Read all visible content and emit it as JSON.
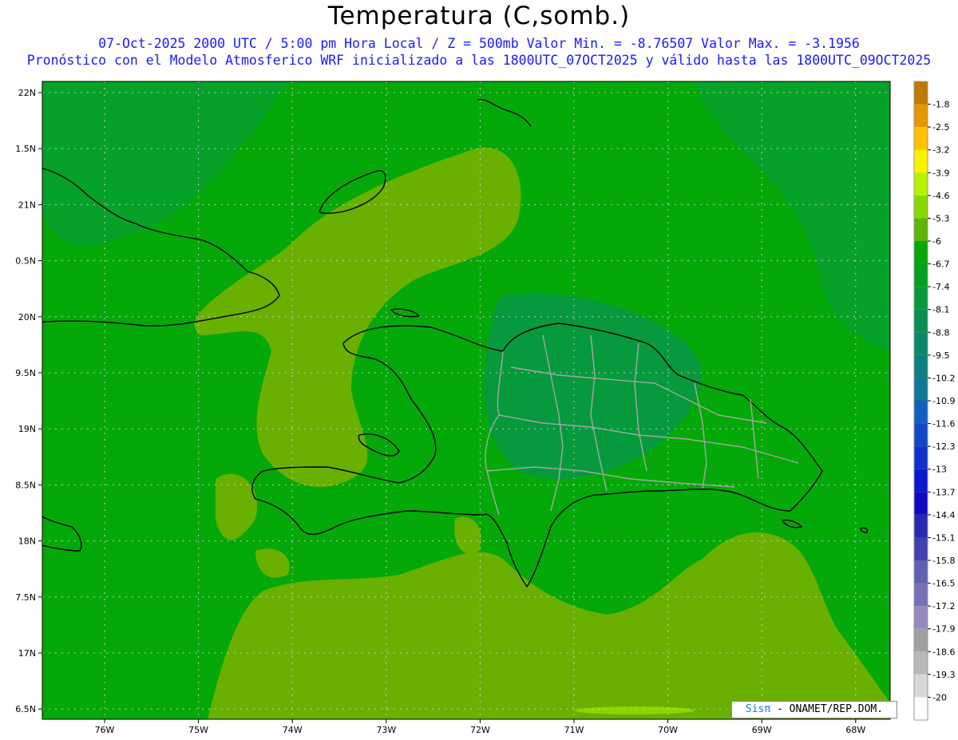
{
  "header": {
    "title": "Temperatura (C,somb.)",
    "line1": "07-Oct-2025  2000 UTC / 5:00 pm Hora Local / Z = 500mb  Valor Min. = -8.76507  Valor Max. = -3.1956",
    "line2": "Pronóstico con el Modelo Atmosferico WRF inicializado a las 1800UTC_07OCT2025 y válido hasta las  1800UTC_09OCT2025"
  },
  "map": {
    "lat_labels": [
      "22N",
      "1.5N",
      "21N",
      "0.5N",
      "20N",
      "9.5N",
      "19N",
      "8.5N",
      "18N",
      "7.5N",
      "17N",
      "6.5N"
    ],
    "lon_labels": [
      "76W",
      "75W",
      "74W",
      "73W",
      "72W",
      "71W",
      "70W",
      "69W",
      "68W"
    ],
    "colors": {
      "background_field": "#04a808",
      "warm_field": "#6ab000",
      "cool_field": "#0a9a3a",
      "coast": "#000000",
      "border": "#a0a0a0"
    }
  },
  "colorbar": {
    "labels": [
      "-1.8",
      "-2.5",
      "-3.2",
      "-3.9",
      "-4.6",
      "-5.3",
      "-6",
      "-6.7",
      "-7.4",
      "-8.1",
      "-8.8",
      "-9.5",
      "-10.2",
      "-10.9",
      "-11.6",
      "-12.3",
      "-13",
      "-13.7",
      "-14.4",
      "-15.1",
      "-15.8",
      "-16.5",
      "-17.2",
      "-17.9",
      "-18.6",
      "-19.3",
      "-20"
    ],
    "colors": [
      "#c07a00",
      "#e69600",
      "#ffc000",
      "#fff000",
      "#b8f000",
      "#88d800",
      "#60b400",
      "#04a808",
      "#02a020",
      "#059a3c",
      "#089050",
      "#0a8868",
      "#0c8080",
      "#0f7898",
      "#1060c0",
      "#1048c8",
      "#0f30cc",
      "#0c18d0",
      "#1008c0",
      "#2828b0",
      "#4040b0",
      "#6060b0",
      "#7870b8",
      "#9888c0",
      "#a0a0a0",
      "#b8b8b8",
      "#d8d8d8",
      "#ffffff"
    ]
  },
  "footer": {
    "logo": "Sisπ",
    "credit": " - ONAMET/REP.DOM."
  }
}
